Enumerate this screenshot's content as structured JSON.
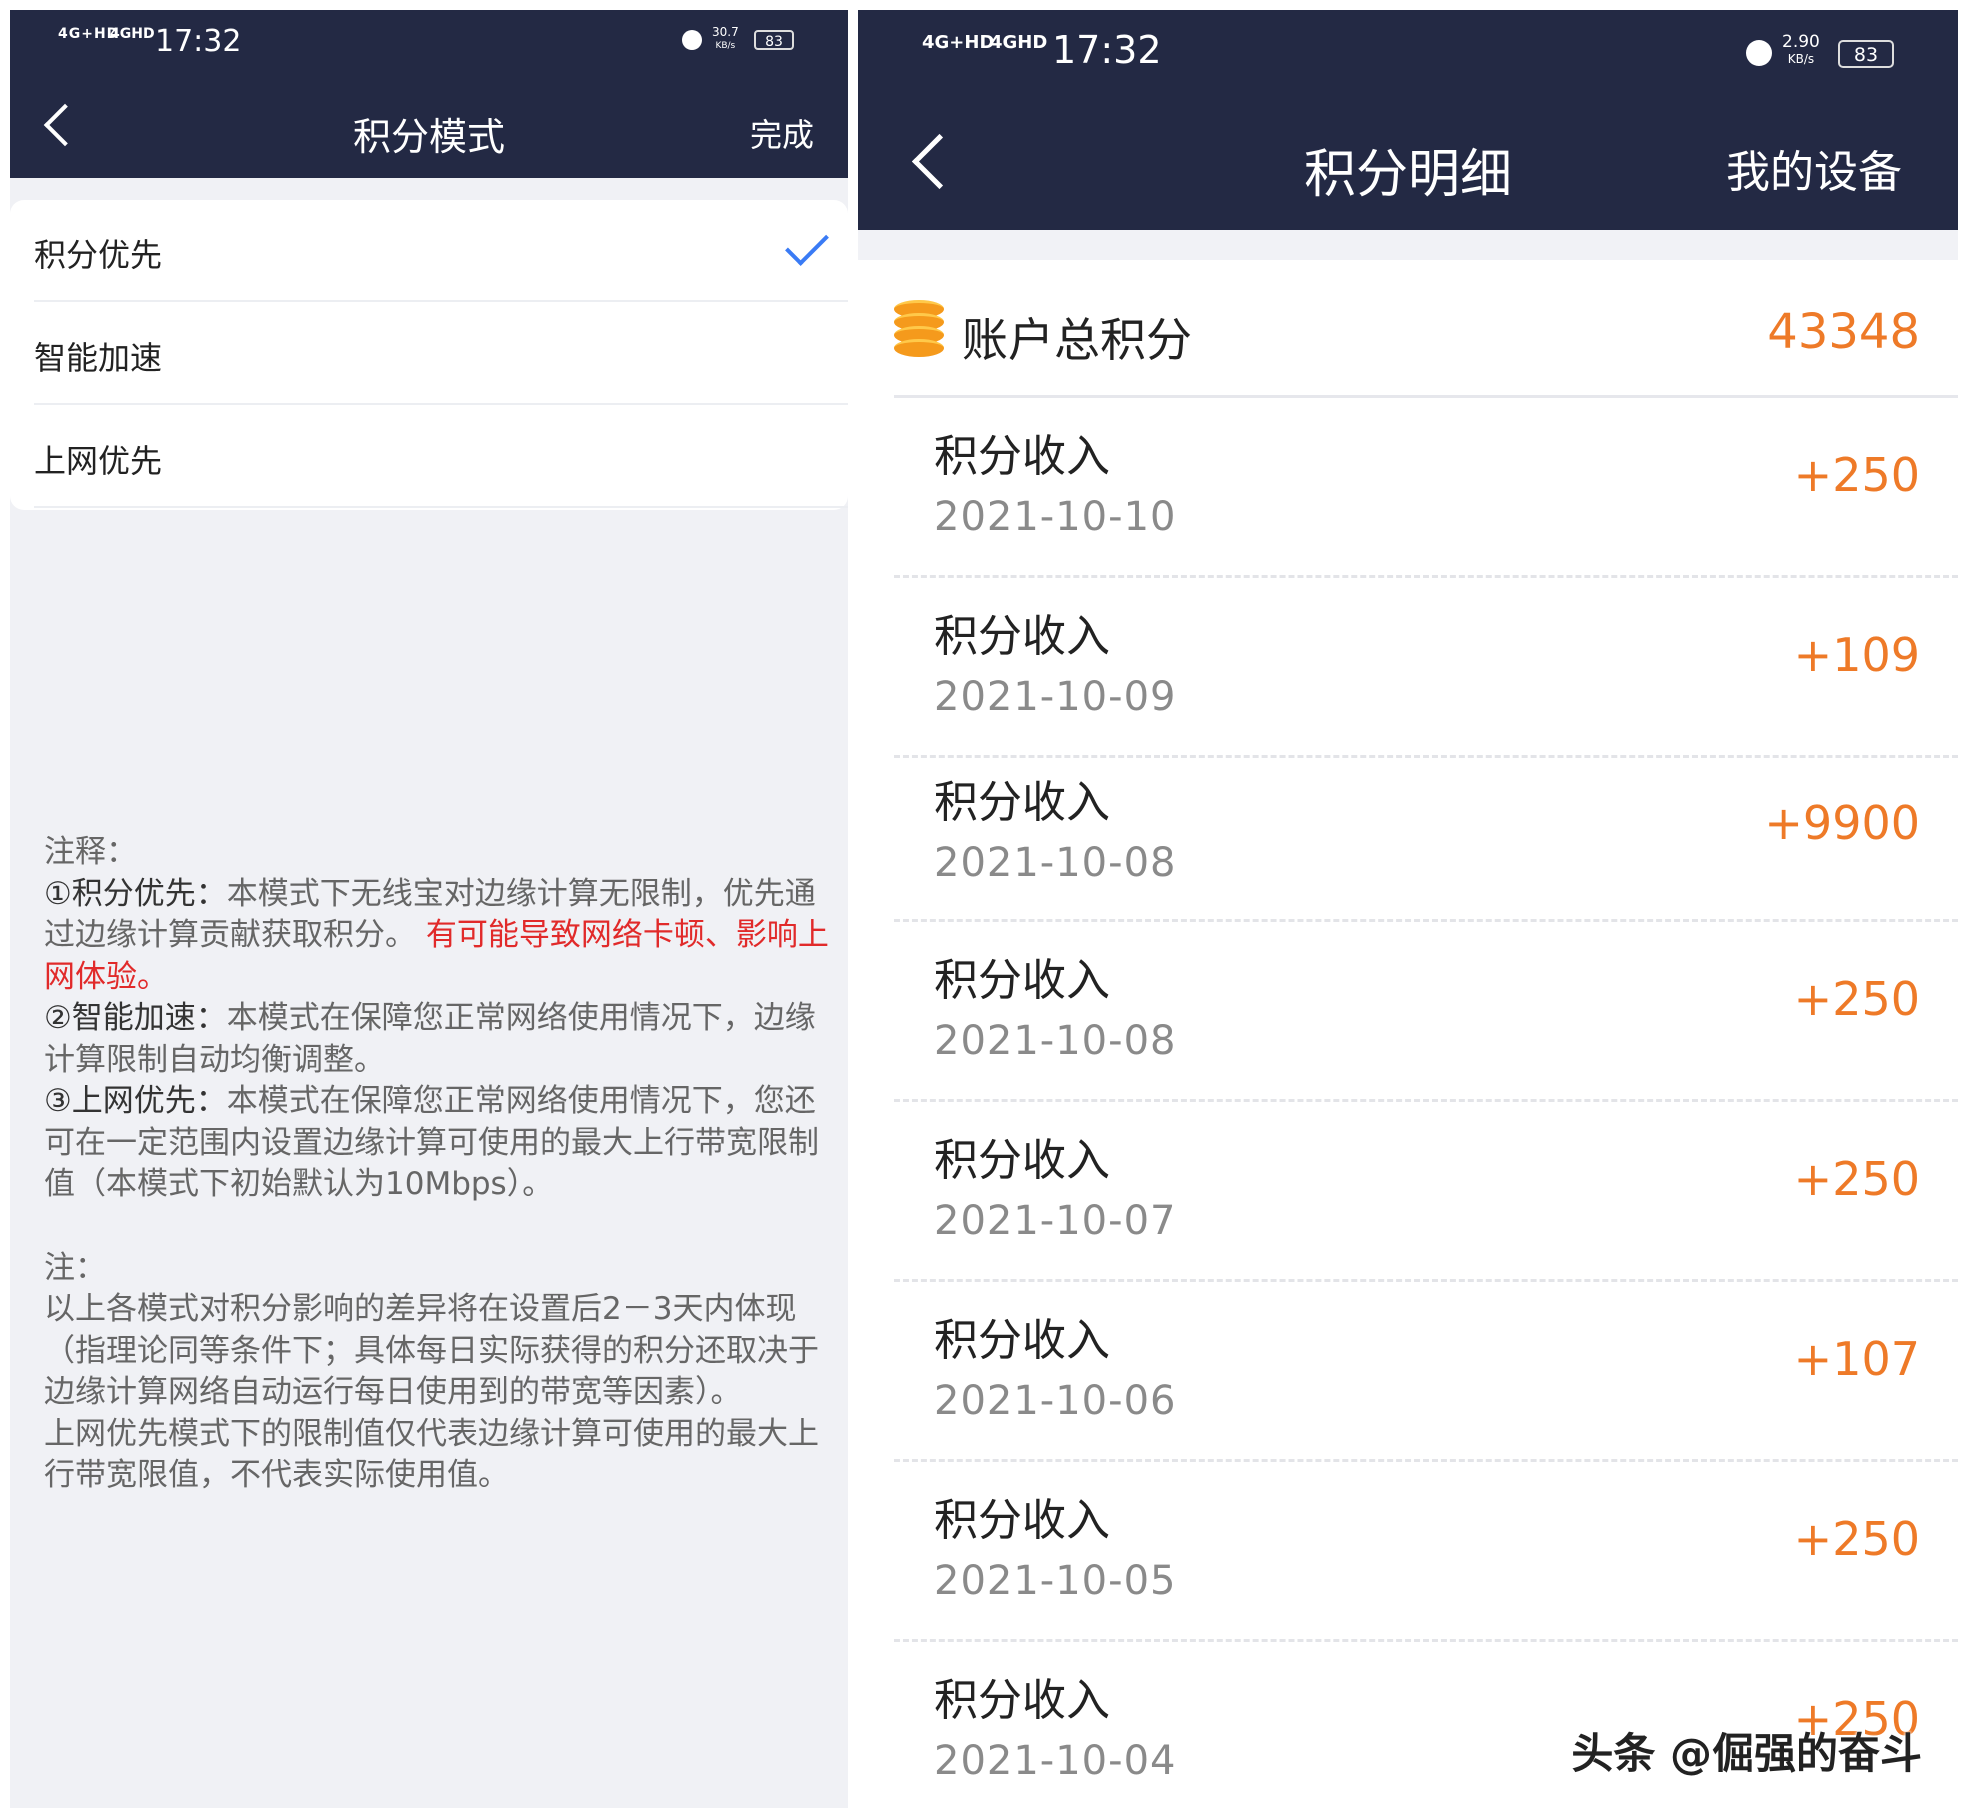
{
  "left_phone": {
    "status": {
      "net1": "4G+HD",
      "net2": "4GHD",
      "time": "17:32",
      "speed_value": "30.7",
      "speed_unit": "KB/s",
      "battery": "83"
    },
    "nav": {
      "title": "积分模式",
      "done_label": "完成"
    },
    "options": [
      {
        "label": "积分优先",
        "selected": true
      },
      {
        "label": "智能加速",
        "selected": false
      },
      {
        "label": "上网优先",
        "selected": false
      }
    ],
    "notes": {
      "heading": "注释：",
      "item1_title": "①积分优先：",
      "item1_text": "本模式下无线宝对边缘计算无限制，优先通过边缘计算贡献获取积分。",
      "item1_warning": "有可能导致网络卡顿、影响上网体验。",
      "item2_title": "②智能加速：",
      "item2_text": "本模式在保障您正常网络使用情况下，边缘计算限制自动均衡调整。",
      "item3_title": "③上网优先：",
      "item3_text": "本模式在保障您正常网络使用情况下，您还可在一定范围内设置边缘计算可使用的最大上行带宽限制值（本模式下初始默认为10Mbps）。",
      "note_heading": "注：",
      "note_text1": "以上各模式对积分影响的差异将在设置后2－3天内体现（指理论同等条件下；具体每日实际获得的积分还取决于边缘计算网络自动运行每日使用到的带宽等因素）。",
      "note_text2": "上网优先模式下的限制值仅代表边缘计算可使用的最大上行带宽限值，不代表实际使用值。"
    },
    "colors": {
      "nav_bg": "#232944",
      "check": "#3a7bf5",
      "warning": "#e12a2a"
    }
  },
  "right_phone": {
    "status": {
      "net1": "4G+HD",
      "net2": "4GHD",
      "time": "17:32",
      "speed_value": "2.90",
      "speed_unit": "KB/s",
      "battery": "83"
    },
    "nav": {
      "title": "积分明细",
      "device_label": "我的设备"
    },
    "total": {
      "label": "账户总积分",
      "value": "43348"
    },
    "records": [
      {
        "label": "积分收入",
        "date": "2021-10-10",
        "amount": "+250"
      },
      {
        "label": "积分收入",
        "date": "2021-10-09",
        "amount": "+109"
      },
      {
        "label": "积分收入",
        "date": "2021-10-08",
        "amount": "+9900"
      },
      {
        "label": "积分收入",
        "date": "2021-10-08",
        "amount": "+250"
      },
      {
        "label": "积分收入",
        "date": "2021-10-07",
        "amount": "+250"
      },
      {
        "label": "积分收入",
        "date": "2021-10-06",
        "amount": "+107"
      },
      {
        "label": "积分收入",
        "date": "2021-10-05",
        "amount": "+250"
      },
      {
        "label": "积分收入",
        "date": "2021-10-04",
        "amount": "+250"
      }
    ],
    "watermark": "头条 @倔强的奋斗",
    "colors": {
      "nav_bg": "#232944",
      "amount": "#ee7a28"
    }
  }
}
